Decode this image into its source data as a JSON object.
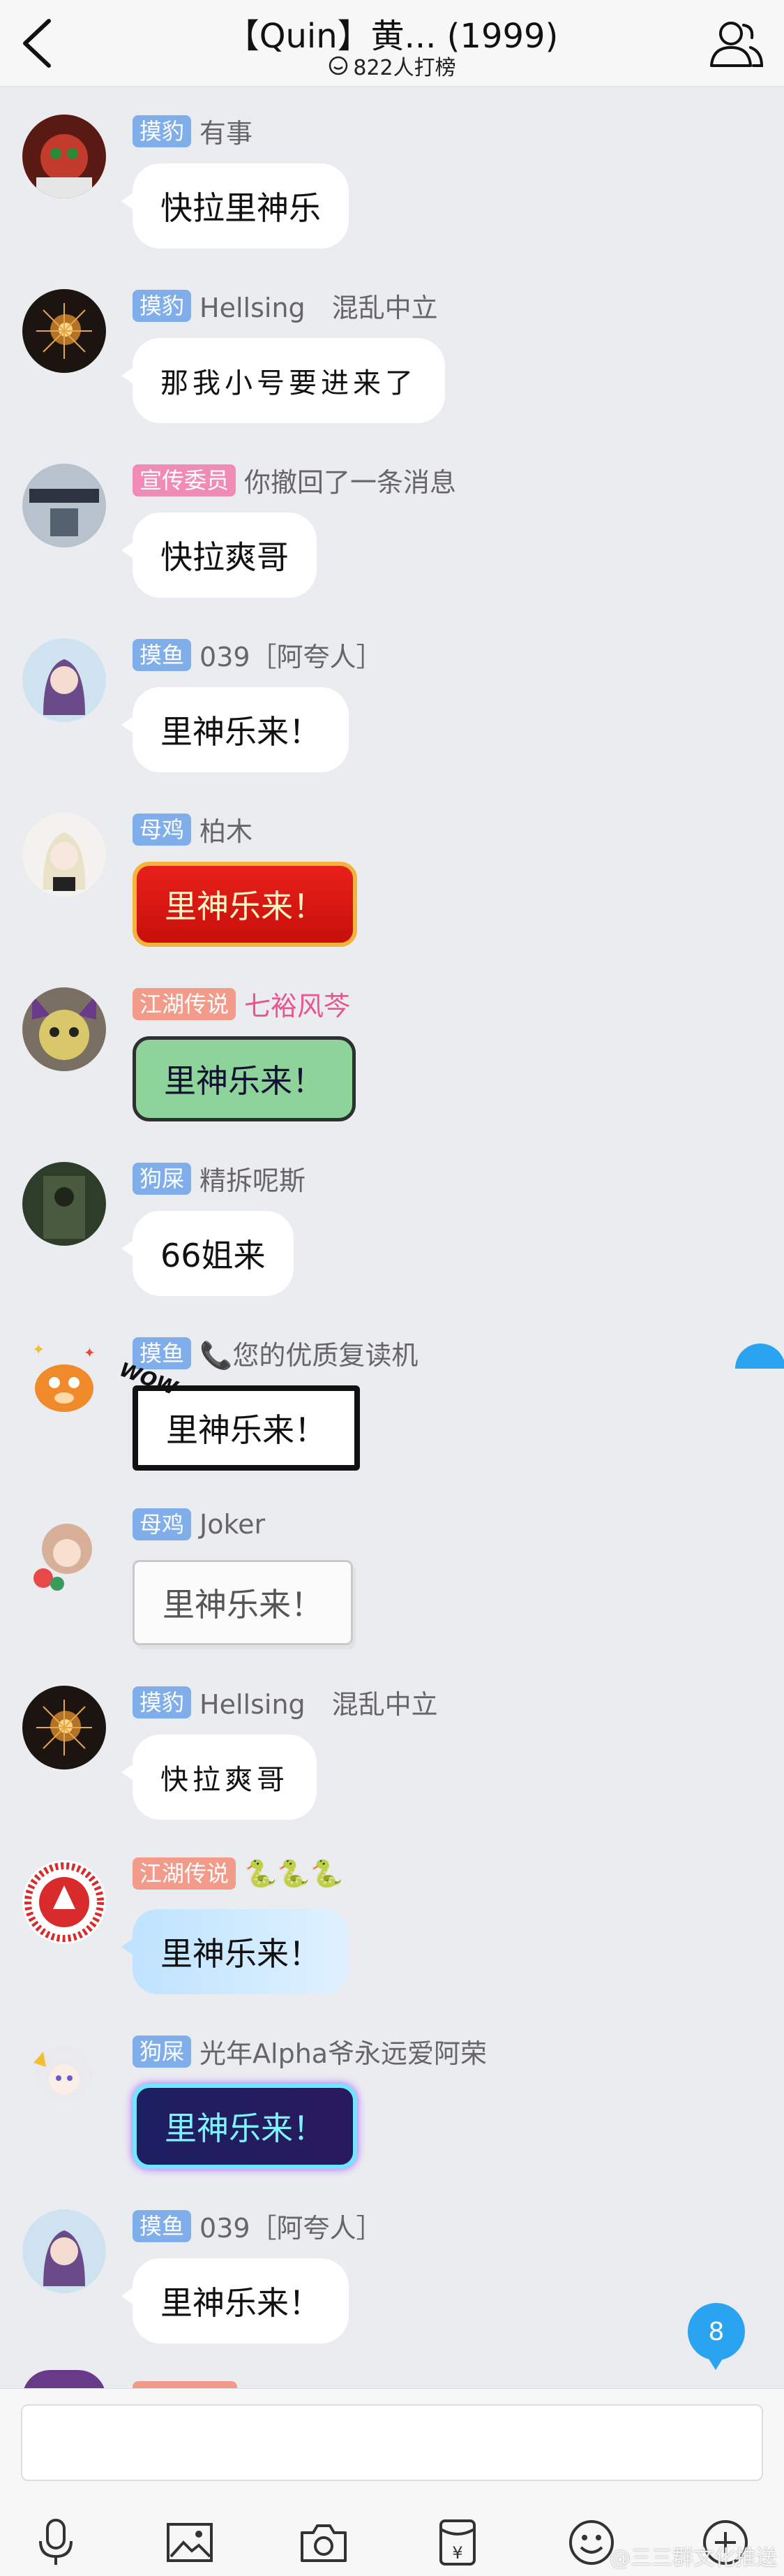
{
  "header": {
    "title": "【Quin】黄... (1999)",
    "subtitle": "822人打榜"
  },
  "messages": [
    {
      "badge": "摸豹",
      "name": "有事",
      "text": "快拉里神乐"
    },
    {
      "badge": "摸豹",
      "name": "Hellsing　混乱中立",
      "text": "那我小号要进来了"
    },
    {
      "badge": "宣传委员",
      "name": "你撤回了一条消息",
      "text": "快拉爽哥"
    },
    {
      "badge": "摸鱼",
      "name": "039［阿夸人］",
      "text": "里神乐来！"
    },
    {
      "badge": "母鸡",
      "name": "柏木",
      "text": "里神乐来！"
    },
    {
      "badge": "江湖传说",
      "name": "七裕风芩",
      "text": "里神乐来！"
    },
    {
      "badge": "狗屎",
      "name": "精拆呢斯",
      "text": "66姐来"
    },
    {
      "badge": "摸鱼",
      "name": "📞您的优质复读机",
      "text": "里神乐来！"
    },
    {
      "badge": "母鸡",
      "name": "Joker",
      "text": "里神乐来！"
    },
    {
      "badge": "摸豹",
      "name": "Hellsing　混乱中立",
      "text": "快拉爽哥"
    },
    {
      "badge": "江湖传说",
      "name": "🐍🐍🐍",
      "text": "里神乐来！"
    },
    {
      "badge": "狗屎",
      "name": "光年Alpha爷永远爱阿荣",
      "text": "里神乐来！"
    },
    {
      "badge": "摸鱼",
      "name": "039［阿夸人］",
      "text": "里神乐来！"
    }
  ],
  "unread_count": "8",
  "comic_tag": "WOW",
  "watermark": "@三三群文化推送"
}
